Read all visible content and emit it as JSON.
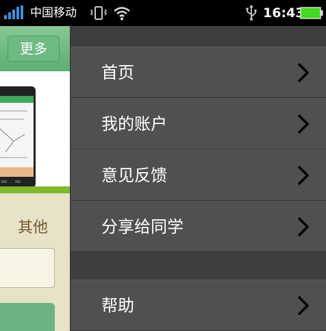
{
  "status_bar": {
    "carrier": "中国移动",
    "time": "16:43",
    "icons": [
      "signal-icon",
      "vibrate-icon",
      "wifi-icon",
      "usb-icon",
      "battery-icon"
    ]
  },
  "background_page": {
    "more_button": "更多",
    "other_label": "其他"
  },
  "menu": {
    "items": [
      {
        "label": "首页"
      },
      {
        "label": "我的账户"
      },
      {
        "label": "意见反馈"
      },
      {
        "label": "分享给同学"
      },
      {
        "label": "帮助"
      }
    ]
  },
  "colors": {
    "status_bar_bg": "#000000",
    "menu_bg": "#505050",
    "accent_green": "#6fb983",
    "battery_green": "#3fdc1f"
  }
}
